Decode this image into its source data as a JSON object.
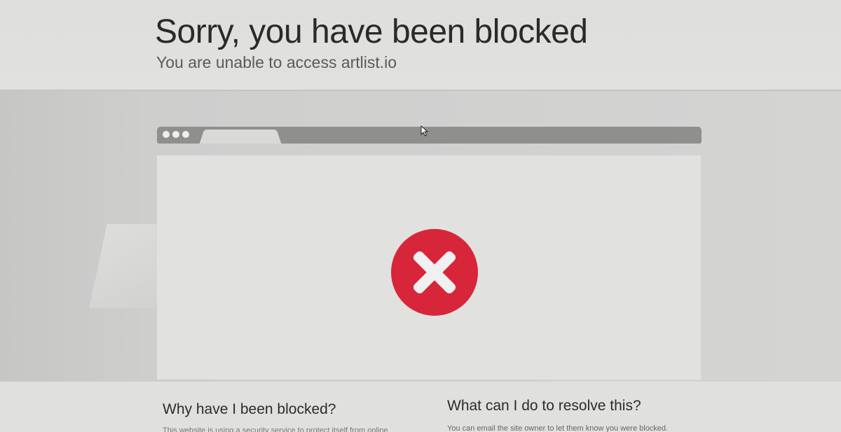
{
  "header": {
    "title": "Sorry, you have been blocked",
    "subtitle": "You are unable to access artlist.io"
  },
  "browser_illustration": {
    "bar_color": "#8f8f8e",
    "tab_color": "#d9d9d8",
    "body_color": "#e1e1df",
    "error_icon": "error-x-circle-icon",
    "error_color": "#d7263a"
  },
  "sections": {
    "why": {
      "heading": "Why have I been blocked?",
      "text": "This website is using a security service to protect itself from online"
    },
    "resolve": {
      "heading": "What can I do to resolve this?",
      "text": "You can email the site owner to let them know you were blocked."
    }
  }
}
